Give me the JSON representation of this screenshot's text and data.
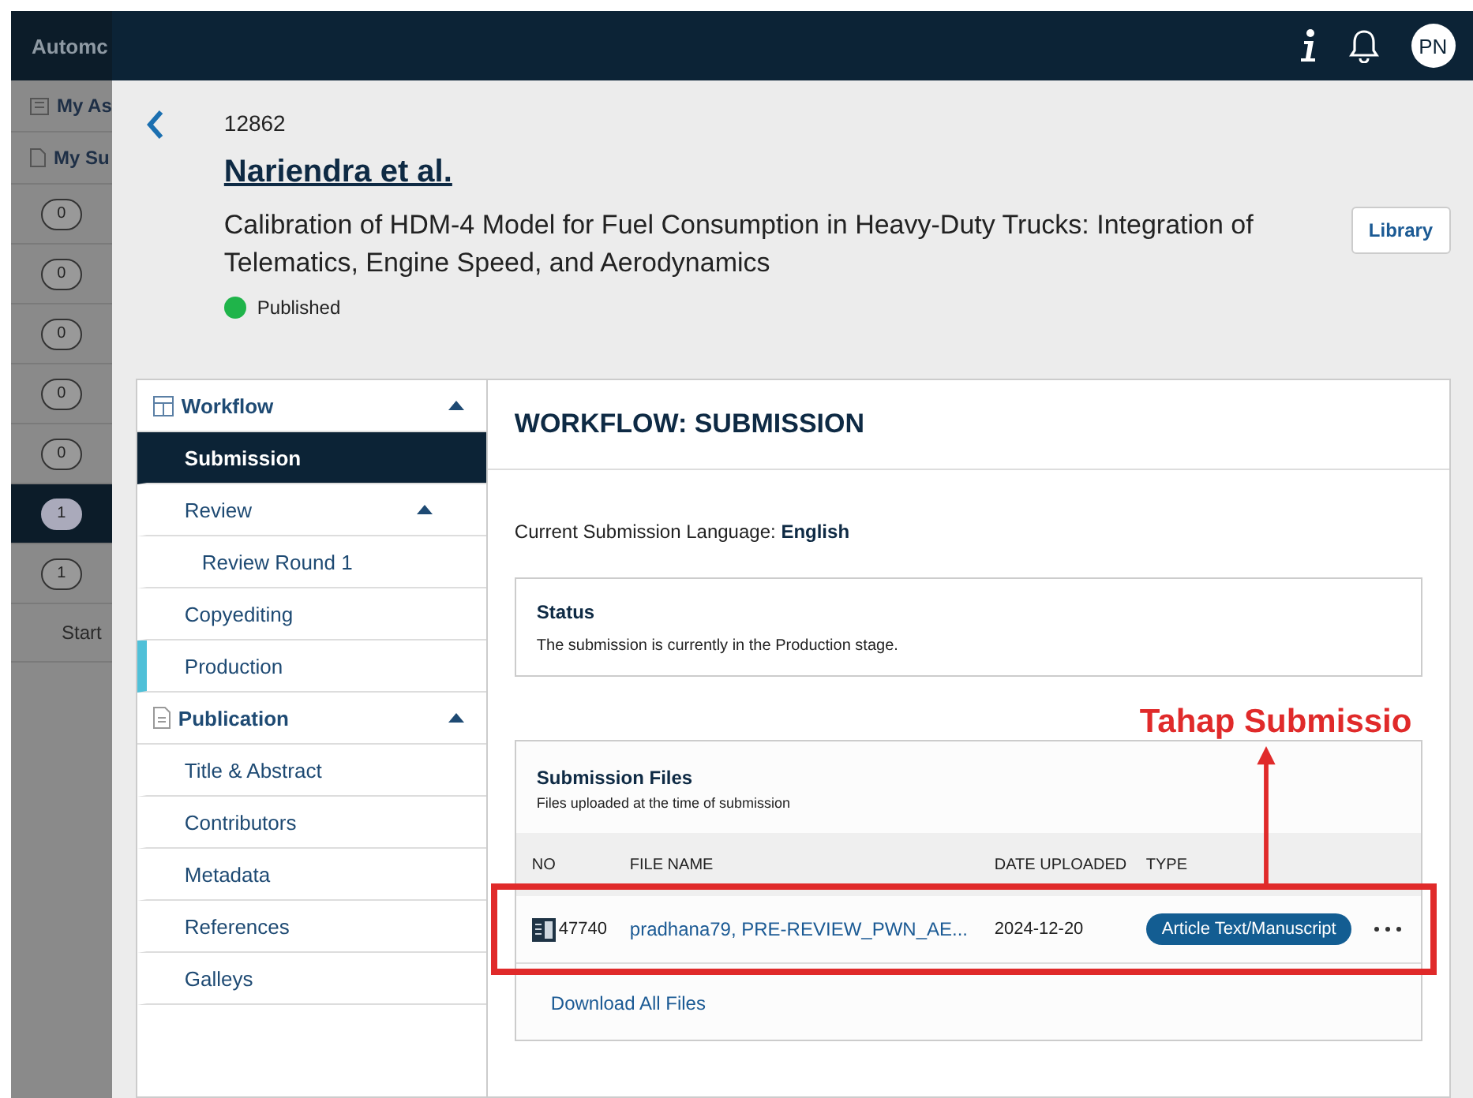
{
  "background_app": {
    "title": "Automc",
    "menu": [
      {
        "label": "My As",
        "kind": "inbox"
      },
      {
        "label": "My Su",
        "kind": "doc"
      }
    ],
    "counts": [
      {
        "count": "0",
        "selected": false
      },
      {
        "count": "0",
        "selected": false
      },
      {
        "count": "0",
        "selected": false
      },
      {
        "count": "0",
        "selected": false
      },
      {
        "count": "0",
        "selected": false
      },
      {
        "count": "1",
        "selected": true
      },
      {
        "count": "1",
        "selected": false
      }
    ],
    "footer": "Start"
  },
  "header": {
    "avatar": "PN"
  },
  "submission": {
    "id": "12862",
    "authors": "Nariendra et al.",
    "title": "Calibration of HDM-4 Model for Fuel Consumption in Heavy-Duty Trucks: Integration of Telematics, Engine Speed, and Aerodynamics",
    "status": "Published",
    "library_button": "Library"
  },
  "nav": [
    {
      "label": "Workflow",
      "kind": "workflow",
      "expanded": true,
      "children": [
        {
          "label": "Submission",
          "selected": true,
          "current_stage": false
        },
        {
          "label": "Review",
          "selected": false,
          "current_stage": false,
          "expanded": true,
          "children": [
            {
              "label": "Review Round 1",
              "selected": false,
              "current_stage": false
            }
          ]
        },
        {
          "label": "Copyediting",
          "selected": false,
          "current_stage": false
        },
        {
          "label": "Production",
          "selected": false,
          "current_stage": true
        }
      ]
    },
    {
      "label": "Publication",
      "kind": "doc",
      "expanded": true,
      "children": [
        {
          "label": "Title & Abstract",
          "selected": false,
          "current_stage": false
        },
        {
          "label": "Contributors",
          "selected": false,
          "current_stage": false
        },
        {
          "label": "Metadata",
          "selected": false,
          "current_stage": false
        },
        {
          "label": "References",
          "selected": false,
          "current_stage": false
        },
        {
          "label": "Galleys",
          "selected": false,
          "current_stage": false
        }
      ]
    }
  ],
  "content": {
    "heading": "WORKFLOW: SUBMISSION",
    "language_label": "Current Submission Language:",
    "language": "English",
    "status_box": {
      "title": "Status",
      "text": "The submission is currently in the Production stage."
    },
    "files": {
      "title": "Submission Files",
      "subtitle": "Files uploaded at the time of submission",
      "columns": [
        "NO",
        "FILE NAME",
        "DATE UPLOADED",
        "TYPE"
      ],
      "rows": [
        {
          "no": "47740",
          "file_name": "pradhana79, PRE-REVIEW_PWN_AE...",
          "date": "2024-12-20",
          "type": "Article Text/Manuscript"
        }
      ],
      "download_link": "Download All Files"
    }
  },
  "annotation": {
    "label": "Tahap Submissio"
  }
}
